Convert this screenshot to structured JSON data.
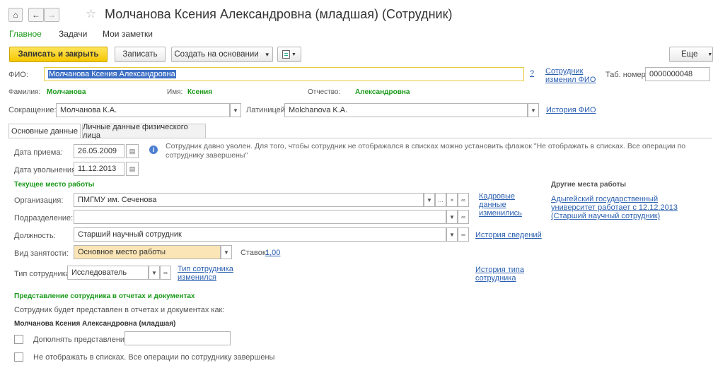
{
  "window": {
    "title": "Молчанова Ксения Александровна (младшая) (Сотрудник)"
  },
  "nav": {
    "main": "Главное",
    "tasks": "Задачи",
    "notes": "Мои заметки"
  },
  "toolbar": {
    "save_close": "Записать и закрыть",
    "save": "Записать",
    "create_based": "Создать на основании",
    "more": "Еще"
  },
  "header": {
    "fio_label": "ФИО:",
    "fio_value": "Молчанова Ксения Александровна",
    "help": "?",
    "fio_changed_link": "Сотрудник изменил ФИО",
    "tab_num_label": "Таб. номер:",
    "tab_num_value": "0000000048",
    "surname_label": "Фамилия:",
    "surname_value": "Молчанова",
    "name_label": "Имя:",
    "name_value": "Ксения",
    "patronymic_label": "Отчество:",
    "patronymic_value": "Александровна",
    "short_label": "Сокращение:",
    "short_value": "Молчанова К.А.",
    "latin_label": "Латиницей:",
    "latin_value": "Molchanova K.A.",
    "fio_history_link": "История ФИО"
  },
  "tabs": [
    {
      "label": "Основные данные"
    },
    {
      "label": "Личные данные физического лица"
    }
  ],
  "main": {
    "hire_label": "Дата приема:",
    "hire_value": "26.05.2009",
    "dismiss_label": "Дата увольнения:",
    "dismiss_value": "11.12.2013",
    "info_text": "Сотрудник давно уволен. Для того, чтобы сотрудник не отображался в списках можно установить флажок \"Не отображать в списках. Все операции по сотруднику завершены\"",
    "current_place_title": "Текущее место работы",
    "org_label": "Организация:",
    "org_value": "ПМГМУ им. Сеченова",
    "hr_link": "Кадровые данные изменились",
    "dept_label": "Подразделение:",
    "dept_value": "",
    "position_label": "Должность:",
    "position_value": "Старший научный сотрудник",
    "info_history_link": "История сведений",
    "employment_label": "Вид занятости:",
    "employment_value": "Основное место работы",
    "rate_label": "Ставок:",
    "rate_value": "1,00",
    "emp_type_label": "Тип сотрудника:",
    "emp_type_value": "Исследователь",
    "emp_type_changed_link": "Тип сотрудника изменился",
    "type_history_link": "История типа сотрудника",
    "other_places_title": "Другие места работы",
    "other_place_link": "Адыгейский государственный университет работает с 12.12.2013 (Старший научный сотрудник)",
    "repr_title": "Представление сотрудника в отчетах и документах",
    "repr_text": "Сотрудник будет представлен в отчетах и документах как:",
    "repr_value": "Молчанова Ксения Александровна (младшая)",
    "supplement_label": "Дополнять представление",
    "supplement_value": "",
    "hide_label": "Не отображать в списках. Все операции по сотруднику завершены"
  },
  "colors": {
    "accent_green": "#1a9a1a",
    "primary_yellow": "#f5c800",
    "link_blue": "#2a5fb0",
    "highlight": "#fbe4b5"
  }
}
